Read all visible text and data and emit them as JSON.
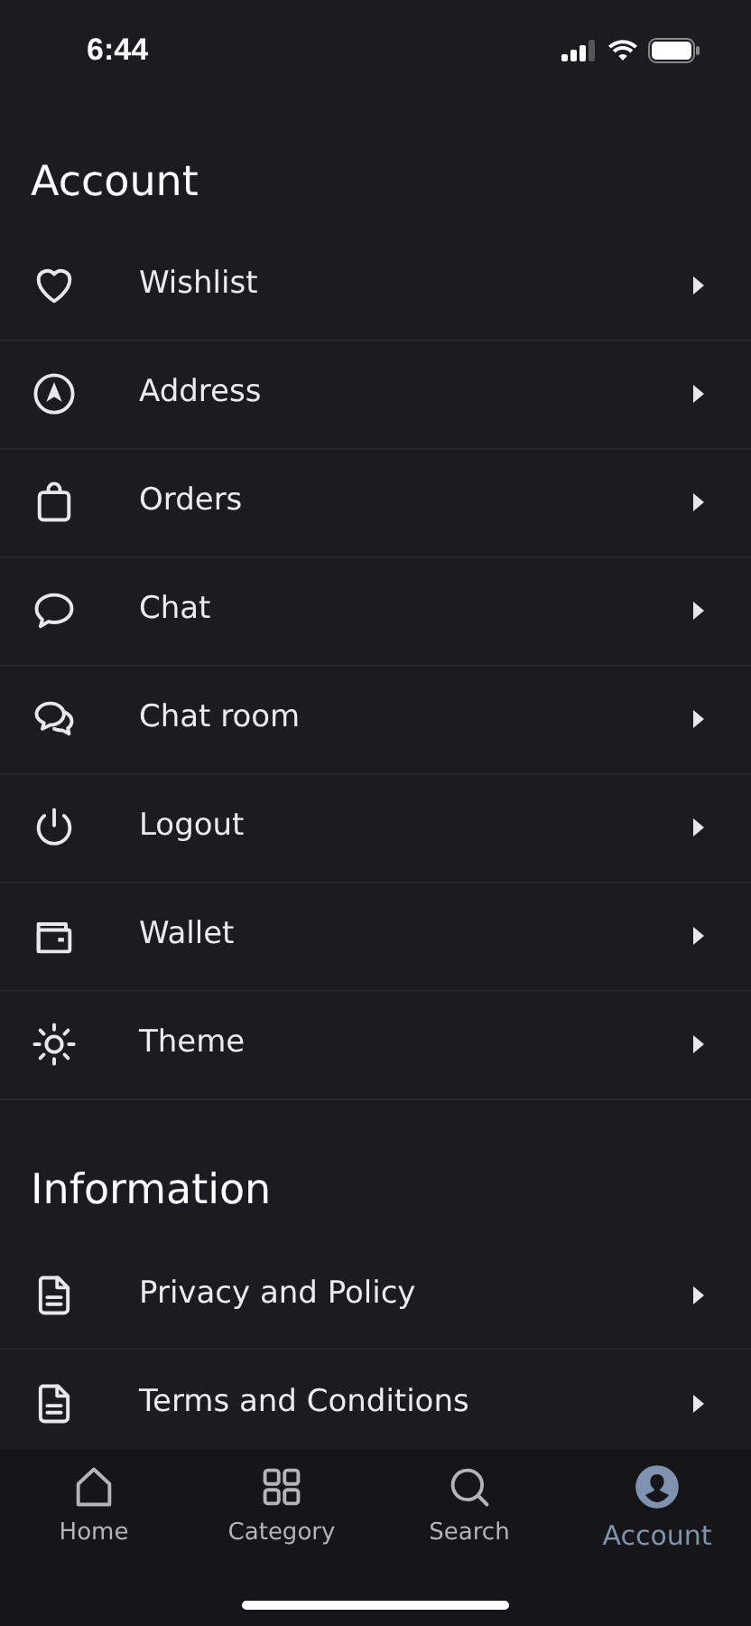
{
  "status_bar": {
    "time": "6:44"
  },
  "sections": [
    {
      "title": "Account",
      "items": [
        {
          "label": "Wishlist",
          "kind": "heart"
        },
        {
          "label": "Address",
          "kind": "navigation"
        },
        {
          "label": "Orders",
          "kind": "bag"
        },
        {
          "label": "Chat",
          "kind": "chat"
        },
        {
          "label": "Chat room",
          "kind": "chats"
        },
        {
          "label": "Logout",
          "kind": "power"
        },
        {
          "label": "Wallet",
          "kind": "wallet"
        },
        {
          "label": "Theme",
          "kind": "sun"
        }
      ]
    },
    {
      "title": "Information",
      "items": [
        {
          "label": "Privacy and Policy",
          "kind": "document"
        },
        {
          "label": "Terms and Conditions",
          "kind": "document"
        }
      ]
    }
  ],
  "tab_bar": [
    {
      "label": "Home",
      "kind": "home",
      "selected": false
    },
    {
      "label": "Category",
      "kind": "grid",
      "selected": false
    },
    {
      "label": "Search",
      "kind": "search",
      "selected": false
    },
    {
      "label": "Account",
      "kind": "person",
      "selected": true
    }
  ]
}
